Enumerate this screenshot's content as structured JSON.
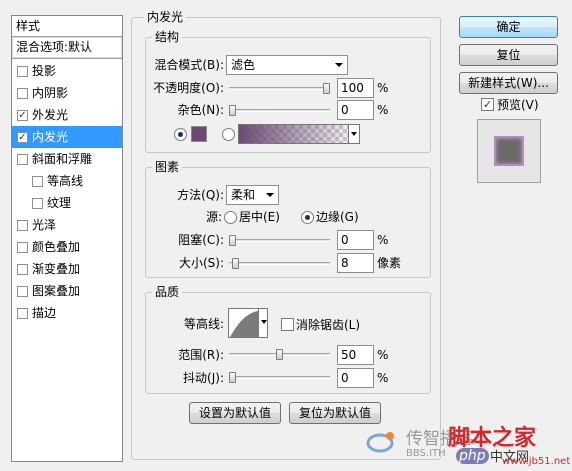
{
  "colors": {
    "selection": "#3399ff",
    "glow_color": "#6b4a73",
    "watermark_red": "#d3272e",
    "watermark_gray": "#9a9a9a"
  },
  "sidebar": {
    "title": "样式",
    "blend_options": "混合选项:默认",
    "items": [
      {
        "label": "投影",
        "checked": false,
        "sub": false,
        "selected": false
      },
      {
        "label": "内阴影",
        "checked": false,
        "sub": false,
        "selected": false
      },
      {
        "label": "外发光",
        "checked": true,
        "sub": false,
        "selected": false
      },
      {
        "label": "内发光",
        "checked": true,
        "sub": false,
        "selected": true
      },
      {
        "label": "斜面和浮雕",
        "checked": false,
        "sub": false,
        "selected": false
      },
      {
        "label": "等高线",
        "checked": false,
        "sub": true,
        "selected": false
      },
      {
        "label": "纹理",
        "checked": false,
        "sub": true,
        "selected": false
      },
      {
        "label": "光泽",
        "checked": false,
        "sub": false,
        "selected": false
      },
      {
        "label": "颜色叠加",
        "checked": false,
        "sub": false,
        "selected": false
      },
      {
        "label": "渐变叠加",
        "checked": false,
        "sub": false,
        "selected": false
      },
      {
        "label": "图案叠加",
        "checked": false,
        "sub": false,
        "selected": false
      },
      {
        "label": "描边",
        "checked": false,
        "sub": false,
        "selected": false
      }
    ]
  },
  "panel": {
    "title": "内发光",
    "structure": {
      "title": "结构",
      "blend_mode_label": "混合模式(B):",
      "blend_mode_value": "滤色",
      "opacity_label": "不透明度(O):",
      "opacity_value": "100",
      "opacity_level": 1.0,
      "noise_label": "杂色(N):",
      "noise_value": "0",
      "noise_level": 0.0,
      "percent": "%",
      "color_mode": "solid"
    },
    "elements": {
      "title": "图素",
      "method_label": "方法(Q):",
      "method_value": "柔和",
      "source_label": "源:",
      "source_center": "居中(E)",
      "source_edge": "边缘(G)",
      "source_selected": "edge",
      "choke_label": "阻塞(C):",
      "choke_value": "0",
      "choke_level": 0.0,
      "size_label": "大小(S):",
      "size_value": "8",
      "size_unit": "像素",
      "size_level": 0.032,
      "percent": "%"
    },
    "quality": {
      "title": "品质",
      "contour_label": "等高线:",
      "antialias_label": "消除锯齿(L)",
      "antialias_checked": false,
      "range_label": "范围(R):",
      "range_value": "50",
      "range_level": 0.5,
      "jitter_label": "抖动(J):",
      "jitter_value": "0",
      "jitter_level": 0.0,
      "percent": "%"
    },
    "set_default": "设置为默认值",
    "reset_default": "复位为默认值"
  },
  "buttons": {
    "ok": "确定",
    "reset": "复位",
    "new_style": "新建样式(W)...",
    "preview_label": "预览(V)",
    "preview_checked": true
  },
  "watermark": {
    "left_text": "传智播客",
    "brand": "脚本之家",
    "url_left": "BBS.ITH",
    "url_right": "www.jb51.net",
    "php_text": "php",
    "cn_text": "中文网"
  }
}
